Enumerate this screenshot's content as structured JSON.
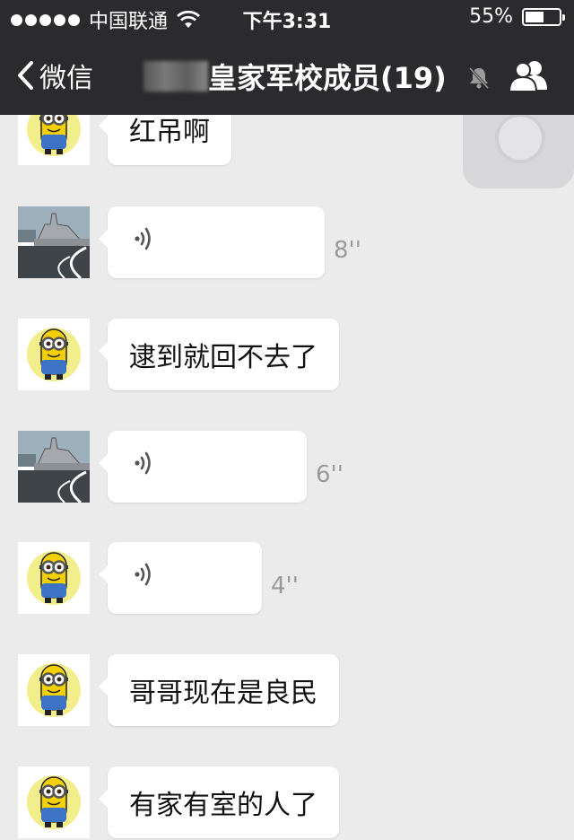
{
  "status_bar": {
    "carrier": "中国联通",
    "time": "下午3:31",
    "battery": "55%",
    "battery_level": 0.55
  },
  "nav": {
    "back_label": "微信",
    "title": "皇家军校成员(19)",
    "icons": [
      "chevron-left-icon",
      "mute-bell-icon",
      "group-members-icon"
    ]
  },
  "messages": [
    {
      "type": "text",
      "avatar": "minion",
      "text": "红吊啊"
    },
    {
      "type": "voice",
      "avatar": "warship",
      "duration": "8''"
    },
    {
      "type": "text",
      "avatar": "minion",
      "text": "逮到就回不去了"
    },
    {
      "type": "voice",
      "avatar": "warship",
      "duration": "6''"
    },
    {
      "type": "voice",
      "avatar": "minion",
      "duration": "4''"
    },
    {
      "type": "text",
      "avatar": "minion",
      "text": "哥哥现在是良民"
    },
    {
      "type": "text",
      "avatar": "minion",
      "text": "有家有室的人了"
    }
  ],
  "colors": {
    "header_bg": "#2b2b2d",
    "chat_bg": "#ebebeb",
    "bubble_bg": "#ffffff",
    "duration_text": "#9a9a9a"
  }
}
